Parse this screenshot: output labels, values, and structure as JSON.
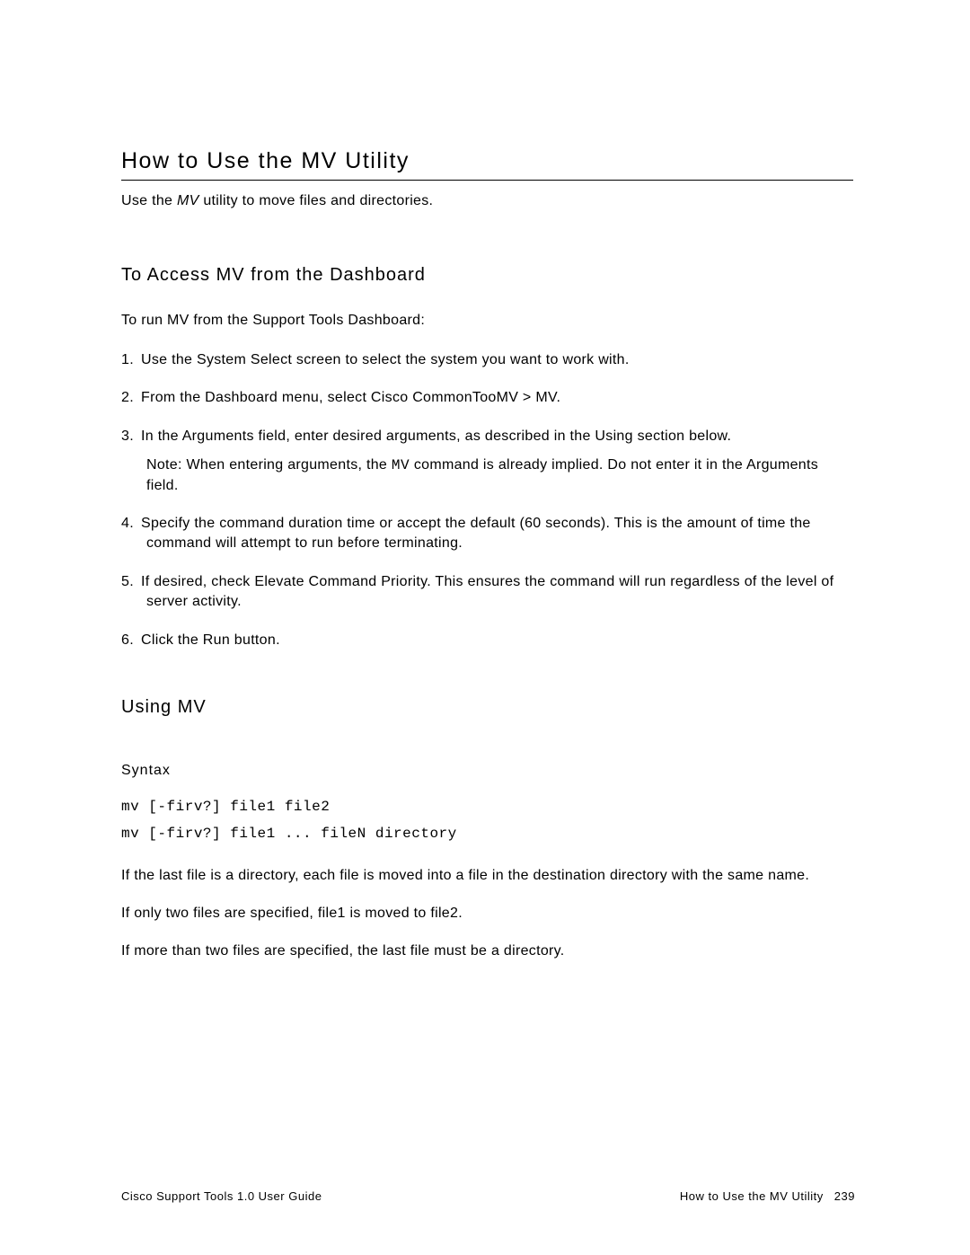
{
  "title": "How to Use the MV Utility",
  "intro_prefix": "Use the ",
  "intro_italic": "MV",
  "intro_suffix": " utility to move files and directories.",
  "section1_heading": "To Access MV from the Dashboard",
  "section1_para": "To run MV from the Support Tools Dashboard:",
  "steps": {
    "s1_num": "1.",
    "s1": "Use the System Select screen to select the system you want to work with.",
    "s2_num": "2.",
    "s2": "From the Dashboard menu, select Cisco CommonTooMV > MV.",
    "s3_num": "3.",
    "s3": "In the Arguments field, enter desired arguments, as described in the Using section below.",
    "s3_note_prefix": "Note: When entering arguments, the ",
    "s3_note_code": "MV",
    "s3_note_suffix": " command is already implied. Do not enter it in the Arguments field.",
    "s4_num": "4.",
    "s4": "Specify the command duration time or accept the default (60 seconds). This is the amount of time the command will attempt to run before terminating.",
    "s5_num": "5.",
    "s5": "If desired, check Elevate Command Priority. This ensures the command will run regardless of the level of server activity.",
    "s6_num": "6.",
    "s6": "Click the Run button."
  },
  "section2_heading": "Using MV",
  "syntax_heading": "Syntax",
  "syntax_code": "mv [-firv?] file1 file2\nmv [-firv?] file1 ... fileN directory",
  "p1": "If the last file is a directory, each file is moved into a file in the destination directory with the same name.",
  "p2": "If only two files are specified, file1 is moved to file2.",
  "p3": "If more than two files are specified, the last file must be a directory.",
  "footer": {
    "left": "Cisco Support Tools 1.0 User Guide",
    "right_title": "How to Use the MV Utility",
    "page_number": "239"
  }
}
